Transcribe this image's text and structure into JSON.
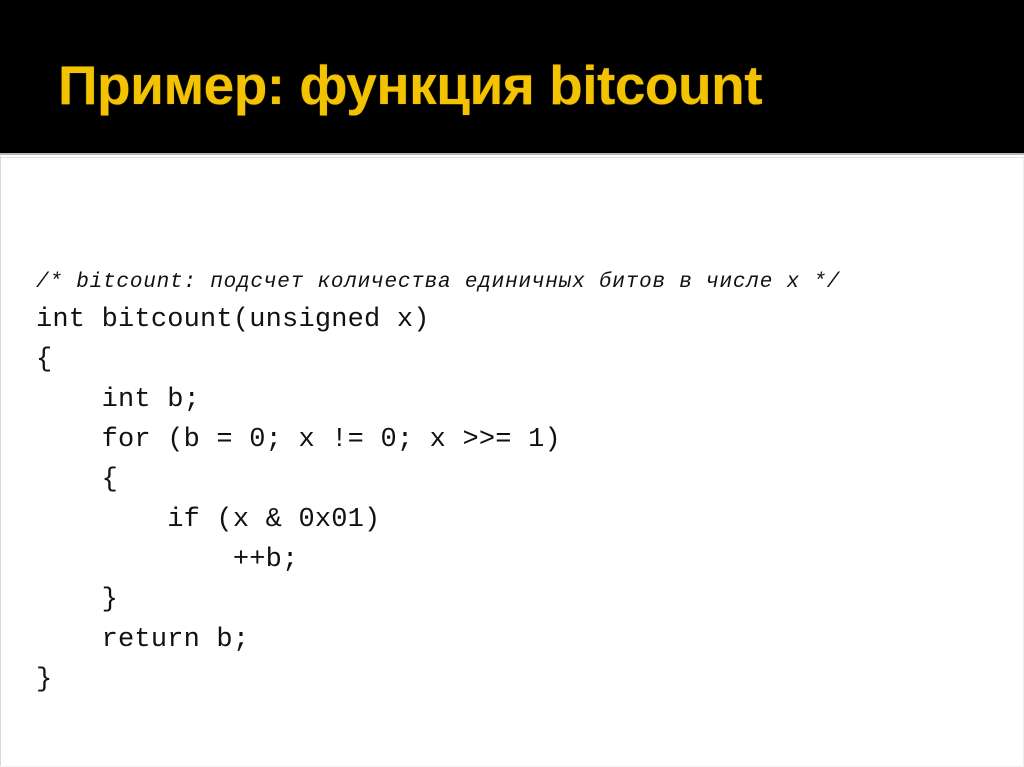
{
  "slide": {
    "title": "Пример: функция bitcount",
    "title_color": "#f3c200",
    "header_background": "#000000",
    "body_background": "#ffffff"
  },
  "code": {
    "language": "C",
    "lines": [
      {
        "id": "comment",
        "text": "/* bitcount: подсчет количества единичных битов в числе x */",
        "style": "comment"
      },
      {
        "id": "signature",
        "text": "int bitcount(unsigned x)",
        "style": "code"
      },
      {
        "id": "open-brace",
        "text": "{",
        "style": "code"
      },
      {
        "id": "decl-b",
        "text": "    int b;",
        "style": "code"
      },
      {
        "id": "for-loop",
        "text": "    for (b = 0; x != 0; x >>= 1)",
        "style": "code"
      },
      {
        "id": "for-open",
        "text": "    {",
        "style": "code"
      },
      {
        "id": "if-test",
        "text": "        if (x & 0x01)",
        "style": "code"
      },
      {
        "id": "increment",
        "text": "            ++b;",
        "style": "code"
      },
      {
        "id": "for-close",
        "text": "    }",
        "style": "code"
      },
      {
        "id": "return-b",
        "text": "    return b;",
        "style": "code"
      },
      {
        "id": "close-brace",
        "text": "}",
        "style": "code"
      }
    ]
  }
}
